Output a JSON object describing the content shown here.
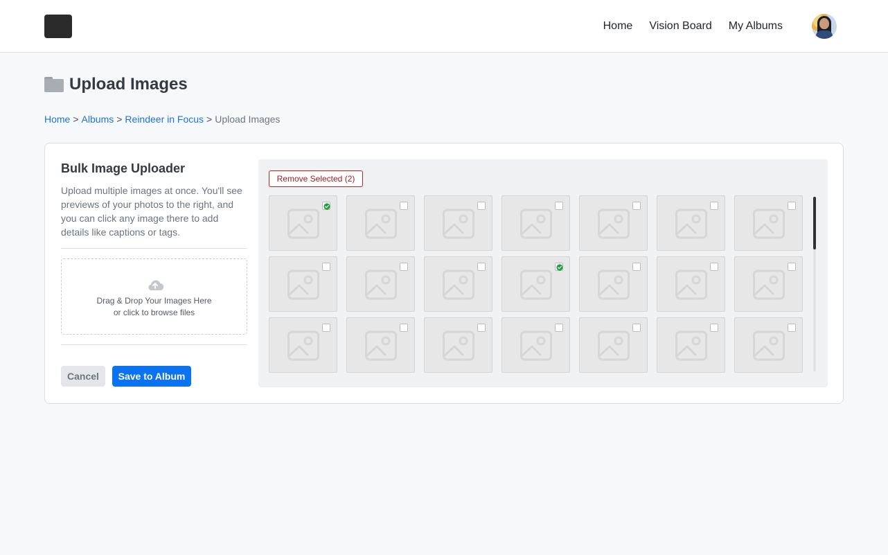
{
  "header": {
    "nav": [
      {
        "label": "Home"
      },
      {
        "label": "Vision Board"
      },
      {
        "label": "My Albums"
      }
    ]
  },
  "page": {
    "title": "Upload Images",
    "breadcrumb": [
      {
        "label": "Home",
        "link": true
      },
      {
        "label": "Albums",
        "link": true
      },
      {
        "label": "Reindeer in Focus",
        "link": true
      },
      {
        "label": "Upload Images",
        "link": false
      }
    ],
    "breadcrumb_separator": ">"
  },
  "uploader": {
    "title": "Bulk Image Uploader",
    "description": "Upload multiple images at once. You'll see previews of your photos to the right, and you can click any image there to add details like captions or tags.",
    "dropzone_line1": "Drag & Drop Your Images Here",
    "dropzone_line2": "or click to browse files",
    "cancel_label": "Cancel",
    "save_label": "Save to Album",
    "remove_selected_label": "Remove Selected (2)"
  },
  "thumbnails": {
    "columns": 7,
    "checked": [
      true,
      false,
      false,
      false,
      false,
      false,
      false,
      false,
      false,
      false,
      true,
      false,
      false,
      false,
      false,
      false,
      false,
      false,
      false,
      false,
      false
    ]
  },
  "colors": {
    "primary": "#0b72f0",
    "danger": "#b3261e",
    "check": "#1e9e3a",
    "link": "#1a73e8"
  }
}
